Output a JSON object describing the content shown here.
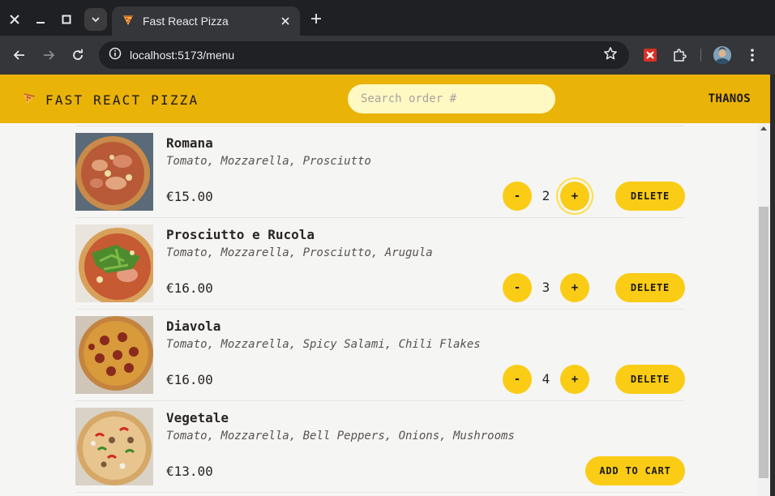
{
  "browser": {
    "tab_title": "Fast React Pizza",
    "url": "localhost:5173/menu",
    "icons": [
      "close-window-icon",
      "minimize-icon",
      "maximize-icon",
      "tab-list-chevron-icon",
      "pizza-favicon",
      "tab-close-icon",
      "new-tab-plus-icon",
      "back-arrow-icon",
      "forward-arrow-icon",
      "reload-icon",
      "site-info-icon",
      "bookmark-star-icon",
      "extension-icon",
      "puzzle-extensions-icon",
      "profile-avatar",
      "kebab-menu-icon"
    ]
  },
  "app": {
    "logo_text": "FAST REACT PIZZA",
    "search_placeholder": "Search order #",
    "username": "THANOS",
    "colors": {
      "header": "#eab308",
      "button": "#facc15",
      "search_bg": "#fef9c3",
      "page_bg": "#f5f5f4"
    }
  },
  "menu": {
    "items": [
      {
        "name": "Romana",
        "ingredients": "Tomato, Mozzarella, Prosciutto",
        "price": "€15.00",
        "quantity": "2",
        "minus_label": "-",
        "plus_label": "+",
        "action_label": "DELETE"
      },
      {
        "name": "Prosciutto e Rucola",
        "ingredients": "Tomato, Mozzarella, Prosciutto, Arugula",
        "price": "€16.00",
        "quantity": "3",
        "minus_label": "-",
        "plus_label": "+",
        "action_label": "DELETE"
      },
      {
        "name": "Diavola",
        "ingredients": "Tomato, Mozzarella, Spicy Salami, Chili Flakes",
        "price": "€16.00",
        "quantity": "4",
        "minus_label": "-",
        "plus_label": "+",
        "action_label": "DELETE"
      },
      {
        "name": "Vegetale",
        "ingredients": "Tomato, Mozzarella, Bell Peppers, Onions, Mushrooms",
        "price": "€13.00",
        "action_label": "ADD TO CART"
      }
    ]
  }
}
